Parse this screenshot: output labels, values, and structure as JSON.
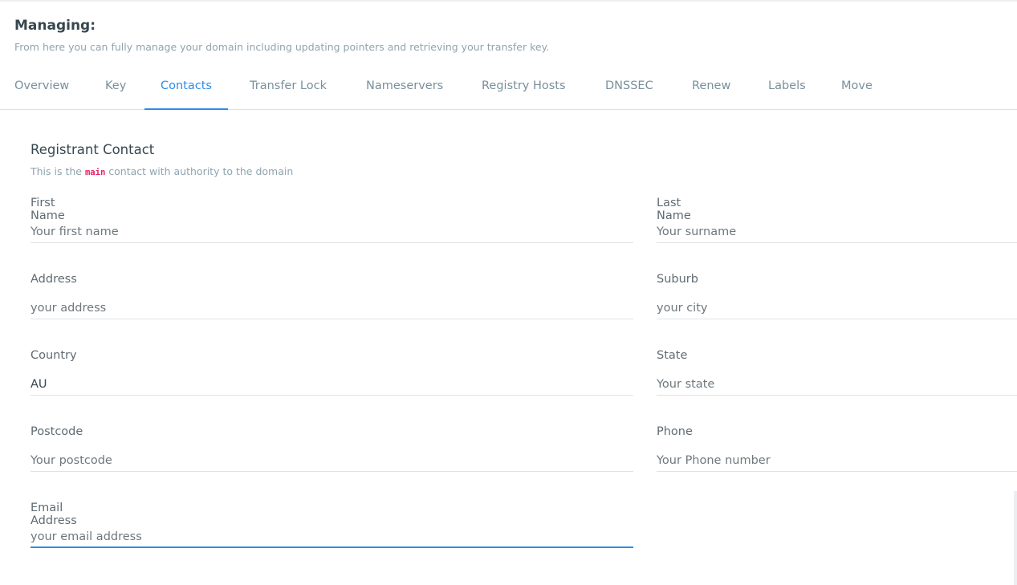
{
  "header": {
    "title": "Managing:",
    "subtitle": "From here you can fully manage your domain including updating pointers and retrieving your transfer key."
  },
  "tabs": [
    {
      "label": "Overview",
      "active": false
    },
    {
      "label": "Key",
      "active": false
    },
    {
      "label": "Contacts",
      "active": true
    },
    {
      "label": "Transfer Lock",
      "active": false
    },
    {
      "label": "Nameservers",
      "active": false
    },
    {
      "label": "Registry Hosts",
      "active": false
    },
    {
      "label": "DNSSEC",
      "active": false
    },
    {
      "label": "Renew",
      "active": false
    },
    {
      "label": "Labels",
      "active": false
    },
    {
      "label": "Move",
      "active": false
    }
  ],
  "contact": {
    "title": "Registrant Contact",
    "sub_before": "This is the",
    "sub_code": "main",
    "sub_after": "contact with authority to the domain"
  },
  "fields": {
    "first_name": {
      "label": "First Name",
      "placeholder": "Your first name",
      "value": ""
    },
    "last_name": {
      "label": "Last Name",
      "placeholder": "Your surname",
      "value": ""
    },
    "address": {
      "label": "Address",
      "placeholder": "your address",
      "value": ""
    },
    "suburb": {
      "label": "Suburb",
      "placeholder": "your city",
      "value": ""
    },
    "country": {
      "label": "Country",
      "placeholder": "",
      "value": "AU"
    },
    "state": {
      "label": "State",
      "placeholder": "Your state",
      "value": ""
    },
    "postcode": {
      "label": "Postcode",
      "placeholder": "Your postcode",
      "value": ""
    },
    "phone": {
      "label": "Phone",
      "placeholder": "Your Phone number",
      "value": ""
    },
    "email": {
      "label": "Email Address",
      "placeholder": "your email address",
      "value": ""
    }
  },
  "colors": {
    "accent": "#2e8ce6",
    "code": "#e91e63",
    "muted": "#90a4ae"
  }
}
